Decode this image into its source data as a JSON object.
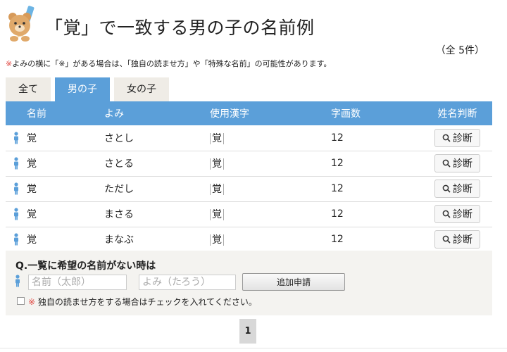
{
  "header": {
    "title": "「覚」で一致する男の子の名前例",
    "count": "（全 5件）",
    "note_mark": "※",
    "note_text": "よみの横に「※」がある場合は、「独自の読ませ方」や「特殊な名前」の可能性があります。"
  },
  "tabs": [
    {
      "label": "全て",
      "active": false
    },
    {
      "label": "男の子",
      "active": true
    },
    {
      "label": "女の子",
      "active": false
    }
  ],
  "table": {
    "headers": [
      "名前",
      "よみ",
      "使用漢字",
      "字画数",
      "姓名判断"
    ],
    "rows": [
      {
        "name": "覚",
        "yomi": "さとし",
        "kanji": "覚",
        "strokes": "12",
        "judge": "診断"
      },
      {
        "name": "覚",
        "yomi": "さとる",
        "kanji": "覚",
        "strokes": "12",
        "judge": "診断"
      },
      {
        "name": "覚",
        "yomi": "ただし",
        "kanji": "覚",
        "strokes": "12",
        "judge": "診断"
      },
      {
        "name": "覚",
        "yomi": "まさる",
        "kanji": "覚",
        "strokes": "12",
        "judge": "診断"
      },
      {
        "name": "覚",
        "yomi": "まなぶ",
        "kanji": "覚",
        "strokes": "12",
        "judge": "診断"
      }
    ]
  },
  "request": {
    "title": "Q.一覧に希望の名前がない時は",
    "name_placeholder": "名前（太郎）",
    "yomi_placeholder": "よみ（たろう）",
    "submit_label": "追加申請",
    "check_mark": "※",
    "check_label": "独自の読ませ方をする場合はチェックを入れてください。"
  },
  "pagination": {
    "current": "1"
  },
  "colors": {
    "accent": "#5b9fd9",
    "tab_bg": "#efece6",
    "male_icon": "#5b9fd9",
    "mark": "#e0453f"
  },
  "icons": {
    "mascot": "bear-pencil-mascot",
    "person": "male-person-icon",
    "search": "magnifier-icon"
  }
}
